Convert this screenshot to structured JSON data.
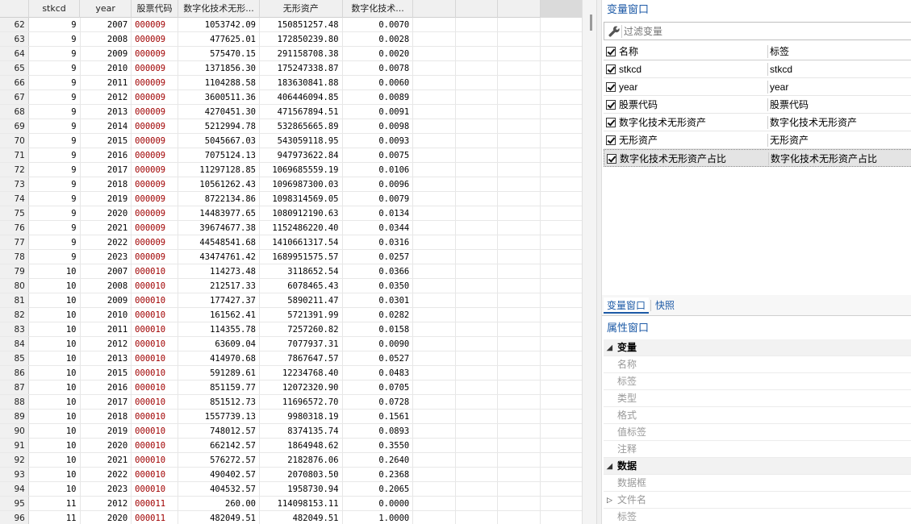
{
  "grid": {
    "columns": [
      "",
      "stkcd",
      "year",
      "股票代码",
      "数字化技术无形...",
      "无形资产",
      "数字化技术...",
      "",
      "",
      "",
      ""
    ],
    "rows": [
      [
        "62",
        "9",
        "2007",
        "000009",
        "1053742.09",
        "150851257.48",
        "0.0070"
      ],
      [
        "63",
        "9",
        "2008",
        "000009",
        "477625.01",
        "172850239.80",
        "0.0028"
      ],
      [
        "64",
        "9",
        "2009",
        "000009",
        "575470.15",
        "291158708.38",
        "0.0020"
      ],
      [
        "65",
        "9",
        "2010",
        "000009",
        "1371856.30",
        "175247338.87",
        "0.0078"
      ],
      [
        "66",
        "9",
        "2011",
        "000009",
        "1104288.58",
        "183630841.88",
        "0.0060"
      ],
      [
        "67",
        "9",
        "2012",
        "000009",
        "3600511.36",
        "406446094.85",
        "0.0089"
      ],
      [
        "68",
        "9",
        "2013",
        "000009",
        "4270451.30",
        "471567894.51",
        "0.0091"
      ],
      [
        "69",
        "9",
        "2014",
        "000009",
        "5212994.78",
        "532865665.89",
        "0.0098"
      ],
      [
        "70",
        "9",
        "2015",
        "000009",
        "5045667.03",
        "543059118.95",
        "0.0093"
      ],
      [
        "71",
        "9",
        "2016",
        "000009",
        "7075124.13",
        "947973622.84",
        "0.0075"
      ],
      [
        "72",
        "9",
        "2017",
        "000009",
        "11297128.85",
        "1069685559.19",
        "0.0106"
      ],
      [
        "73",
        "9",
        "2018",
        "000009",
        "10561262.43",
        "1096987300.03",
        "0.0096"
      ],
      [
        "74",
        "9",
        "2019",
        "000009",
        "8722134.86",
        "1098314569.05",
        "0.0079"
      ],
      [
        "75",
        "9",
        "2020",
        "000009",
        "14483977.65",
        "1080912190.63",
        "0.0134"
      ],
      [
        "76",
        "9",
        "2021",
        "000009",
        "39674677.38",
        "1152486220.40",
        "0.0344"
      ],
      [
        "77",
        "9",
        "2022",
        "000009",
        "44548541.68",
        "1410661317.54",
        "0.0316"
      ],
      [
        "78",
        "9",
        "2023",
        "000009",
        "43474761.42",
        "1689951575.57",
        "0.0257"
      ],
      [
        "79",
        "10",
        "2007",
        "000010",
        "114273.48",
        "3118652.54",
        "0.0366"
      ],
      [
        "80",
        "10",
        "2008",
        "000010",
        "212517.33",
        "6078465.43",
        "0.0350"
      ],
      [
        "81",
        "10",
        "2009",
        "000010",
        "177427.37",
        "5890211.47",
        "0.0301"
      ],
      [
        "82",
        "10",
        "2010",
        "000010",
        "161562.41",
        "5721391.99",
        "0.0282"
      ],
      [
        "83",
        "10",
        "2011",
        "000010",
        "114355.78",
        "7257260.82",
        "0.0158"
      ],
      [
        "84",
        "10",
        "2012",
        "000010",
        "63609.04",
        "7077937.31",
        "0.0090"
      ],
      [
        "85",
        "10",
        "2013",
        "000010",
        "414970.68",
        "7867647.57",
        "0.0527"
      ],
      [
        "86",
        "10",
        "2015",
        "000010",
        "591289.61",
        "12234768.40",
        "0.0483"
      ],
      [
        "87",
        "10",
        "2016",
        "000010",
        "851159.77",
        "12072320.90",
        "0.0705"
      ],
      [
        "88",
        "10",
        "2017",
        "000010",
        "851512.73",
        "11696572.70",
        "0.0728"
      ],
      [
        "89",
        "10",
        "2018",
        "000010",
        "1557739.13",
        "9980318.19",
        "0.1561"
      ],
      [
        "90",
        "10",
        "2019",
        "000010",
        "748012.57",
        "8374135.74",
        "0.0893"
      ],
      [
        "91",
        "10",
        "2020",
        "000010",
        "662142.57",
        "1864948.62",
        "0.3550"
      ],
      [
        "92",
        "10",
        "2021",
        "000010",
        "576272.57",
        "2182876.06",
        "0.2640"
      ],
      [
        "93",
        "10",
        "2022",
        "000010",
        "490402.57",
        "2070803.50",
        "0.2368"
      ],
      [
        "94",
        "10",
        "2023",
        "000010",
        "404532.57",
        "1958730.94",
        "0.2065"
      ],
      [
        "95",
        "11",
        "2012",
        "000011",
        "260.00",
        "114098153.11",
        "0.0000"
      ],
      [
        "96",
        "11",
        "2020",
        "000011",
        "482049.51",
        "482049.51",
        "1.0000"
      ]
    ]
  },
  "variables": {
    "title": "变量窗口",
    "filter_placeholder": "过滤变量",
    "header": {
      "name": "名称",
      "label": "标签"
    },
    "items": [
      {
        "name": "stkcd",
        "label": "stkcd"
      },
      {
        "name": "year",
        "label": "year"
      },
      {
        "name": "股票代码",
        "label": "股票代码"
      },
      {
        "name": "数字化技术无形资产",
        "label": "数字化技术无形资产"
      },
      {
        "name": "无形资产",
        "label": "无形资产"
      },
      {
        "name": "数字化技术无形资产占比",
        "label": "数字化技术无形资产占比"
      }
    ],
    "selected_index": 5
  },
  "tabs": {
    "var": "变量窗口",
    "snap": "快照"
  },
  "properties": {
    "title": "属性窗口",
    "groups": [
      {
        "label": "变量",
        "items": [
          "名称",
          "标签",
          "类型",
          "格式",
          "值标签",
          "注释"
        ]
      },
      {
        "label": "数据",
        "items": [
          "数据框",
          "文件名",
          "标签"
        ]
      }
    ]
  },
  "colors": {
    "accent": "#1d5aa6",
    "string_value": "#a00000"
  },
  "icons": {
    "filter": "wrench-icon",
    "expand": "triangle-icon"
  }
}
